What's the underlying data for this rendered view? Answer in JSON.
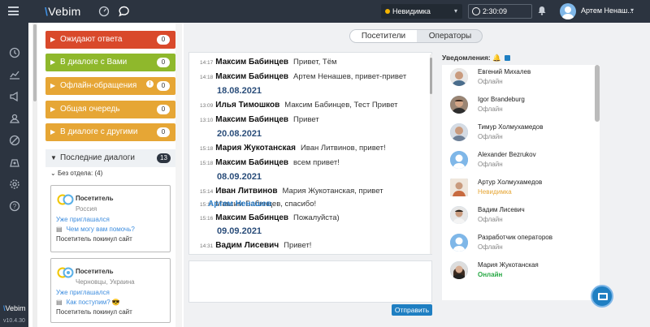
{
  "header": {
    "logo_text": "Vebim",
    "status_label": "Невидимка",
    "timer": "2:30:09",
    "user_name": "Артем Ненаш..."
  },
  "rail": {
    "logo": "Vebim",
    "version": "v10.4.30"
  },
  "queues": [
    {
      "label": "Ожидают ответа",
      "count": "0",
      "color": "#d9492b"
    },
    {
      "label": "В диалоге с Вами",
      "count": "0",
      "color": "#8fb82c"
    },
    {
      "label": "Офлайн-обращения",
      "count": "0",
      "color": "#e6a635",
      "info": "!"
    },
    {
      "label": "Общая очередь",
      "count": "0",
      "color": "#e6a635"
    },
    {
      "label": "В диалоге с другими",
      "count": "0",
      "color": "#e6a635"
    }
  ],
  "recent": {
    "label": "Последние диалоги",
    "count": "13",
    "department": "Без отдела:",
    "department_count": "(4)"
  },
  "visitor_cards": [
    {
      "name": "Посетитель",
      "location": "Россия",
      "invited": "Уже приглашался",
      "message": "Чем могу вам помочь?",
      "status": "Посетитель покинул сайт"
    },
    {
      "name": "Посетитель",
      "location": "Черновцы, Украина",
      "invited": "Уже приглашался",
      "message": "Как поступим? 😎",
      "status": "Посетитель покинул сайт"
    }
  ],
  "tabs": {
    "visitors": "Посетители",
    "operators": "Операторы"
  },
  "chat_lines": [
    {
      "time": "14:17",
      "name": "Максим Бабинцев",
      "text": "Привет, Тём"
    },
    {
      "time": "14:18",
      "name": "Максим Бабинцев",
      "text": "Артем Ненашев, привет-привет"
    },
    {
      "date": "18.08.2021"
    },
    {
      "time": "13:09",
      "name": "Илья Тимошков",
      "text": "Максим Бабинцев, Тест Привет"
    },
    {
      "time": "13:10",
      "name": "Максим Бабинцев",
      "text": "Привет"
    },
    {
      "date": "20.08.2021"
    },
    {
      "time": "15:18",
      "name": "Мария Жукотанская",
      "text": "Иван Литвинов, привет!"
    },
    {
      "time": "15:18",
      "name": "Максим Бабинцев",
      "text": "всем привет!"
    },
    {
      "date": "08.09.2021"
    },
    {
      "time": "15:14",
      "name": "Иван Литвинов",
      "text": "Мария Жукотанская, привет"
    },
    {
      "time": "15:15",
      "name": "Артем Ненашев",
      "text": "Максим Бабинцев, спасибо!",
      "self": true
    },
    {
      "time": "15:16",
      "name": "Максим Бабинцев",
      "text": "Пожалуйста)"
    },
    {
      "date": "09.09.2021"
    },
    {
      "time": "14:31",
      "name": "Вадим Лисевич",
      "text": "Привет!"
    }
  ],
  "send_label": "Отправить",
  "notifications_label": "Уведомления:",
  "operators": [
    {
      "name": "Евгений Михалев",
      "status": "Офлайн",
      "state": "offline"
    },
    {
      "name": "Igor Brandeburg",
      "status": "Офлайн",
      "state": "offline"
    },
    {
      "name": "Тимур Холмухамедов",
      "status": "Офлайн",
      "state": "offline"
    },
    {
      "name": "Alexander Bezrukov",
      "status": "Офлайн",
      "state": "offline"
    },
    {
      "name": "Артур Холмухамедов",
      "status": "Невидимка",
      "state": "invisible"
    },
    {
      "name": "Вадим Лисевич",
      "status": "Офлайн",
      "state": "offline"
    },
    {
      "name": "Разработчик операторов",
      "status": "Офлайн",
      "state": "offline"
    },
    {
      "name": "Мария Жукотанская",
      "status": "Онлайн",
      "state": "online"
    }
  ]
}
